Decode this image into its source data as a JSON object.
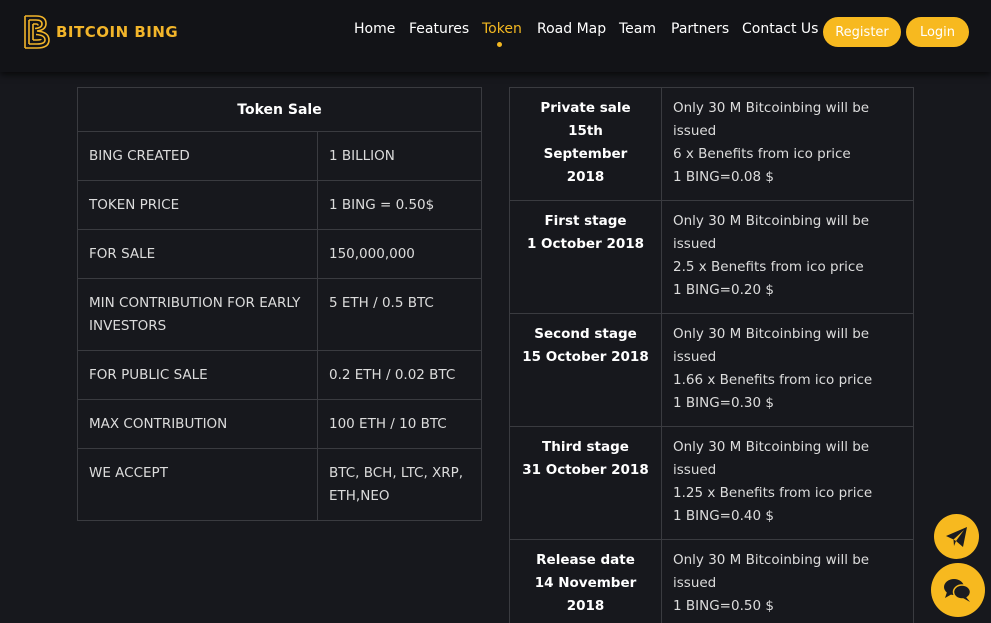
{
  "brand": {
    "name": "BITCOIN BING",
    "color": "#f2b52a"
  },
  "nav": {
    "items": [
      "Home",
      "Features",
      "Token",
      "Road Map",
      "Team",
      "Partners",
      "Contact Us"
    ],
    "active": "Token",
    "register_label": "Register",
    "login_label": "Login"
  },
  "token_sale": {
    "title": "Token Sale",
    "rows": [
      {
        "key": "BING CREATED",
        "value": "1 BILLION"
      },
      {
        "key": "TOKEN PRICE",
        "value": "1 BING = 0.50$"
      },
      {
        "key": "FOR SALE",
        "value": "150,000,000"
      },
      {
        "key": "MIN CONTRIBUTION FOR EARLY INVESTORS",
        "value": "5 ETH / 0.5 BTC"
      },
      {
        "key": "FOR PUBLIC SALE",
        "value": "0.2 ETH / 0.02 BTC"
      },
      {
        "key": "MAX CONTRIBUTION",
        "value": "100 ETH / 10 BTC"
      },
      {
        "key": "WE ACCEPT",
        "value": "BTC, BCH, LTC, XRP, ETH,NEO"
      }
    ]
  },
  "stages": [
    {
      "name": "Private sale",
      "date": "15th September 2018",
      "supply": "Only 30 M Bitcoinbing will be issued",
      "benefits": "6 x Benefits from ico price",
      "price": "1 BING=0.08 $"
    },
    {
      "name": "First stage",
      "date": "1 October 2018",
      "supply": "Only 30 M Bitcoinbing will be issued",
      "benefits": "2.5 x Benefits from ico price",
      "price": "1 BING=0.20 $"
    },
    {
      "name": "Second stage",
      "date": "15 October 2018",
      "supply": "Only 30 M Bitcoinbing will be issued",
      "benefits": "1.66 x Benefits from ico price",
      "price": "1 BING=0.30 $"
    },
    {
      "name": "Third stage",
      "date": "31 October 2018",
      "supply": "Only 30 M Bitcoinbing will be issued",
      "benefits": "1.25 x Benefits from ico price",
      "price": "1 BING=0.40 $"
    },
    {
      "name": "Release date",
      "date": "14 November 2018",
      "supply": "Only 30 M Bitcoinbing will be issued",
      "benefits": "",
      "price": "1 BING=0.50 $"
    }
  ],
  "floating": {
    "telegram_icon": "telegram-icon",
    "chat_icon": "chat-icon",
    "accent": "#f7b91f"
  }
}
